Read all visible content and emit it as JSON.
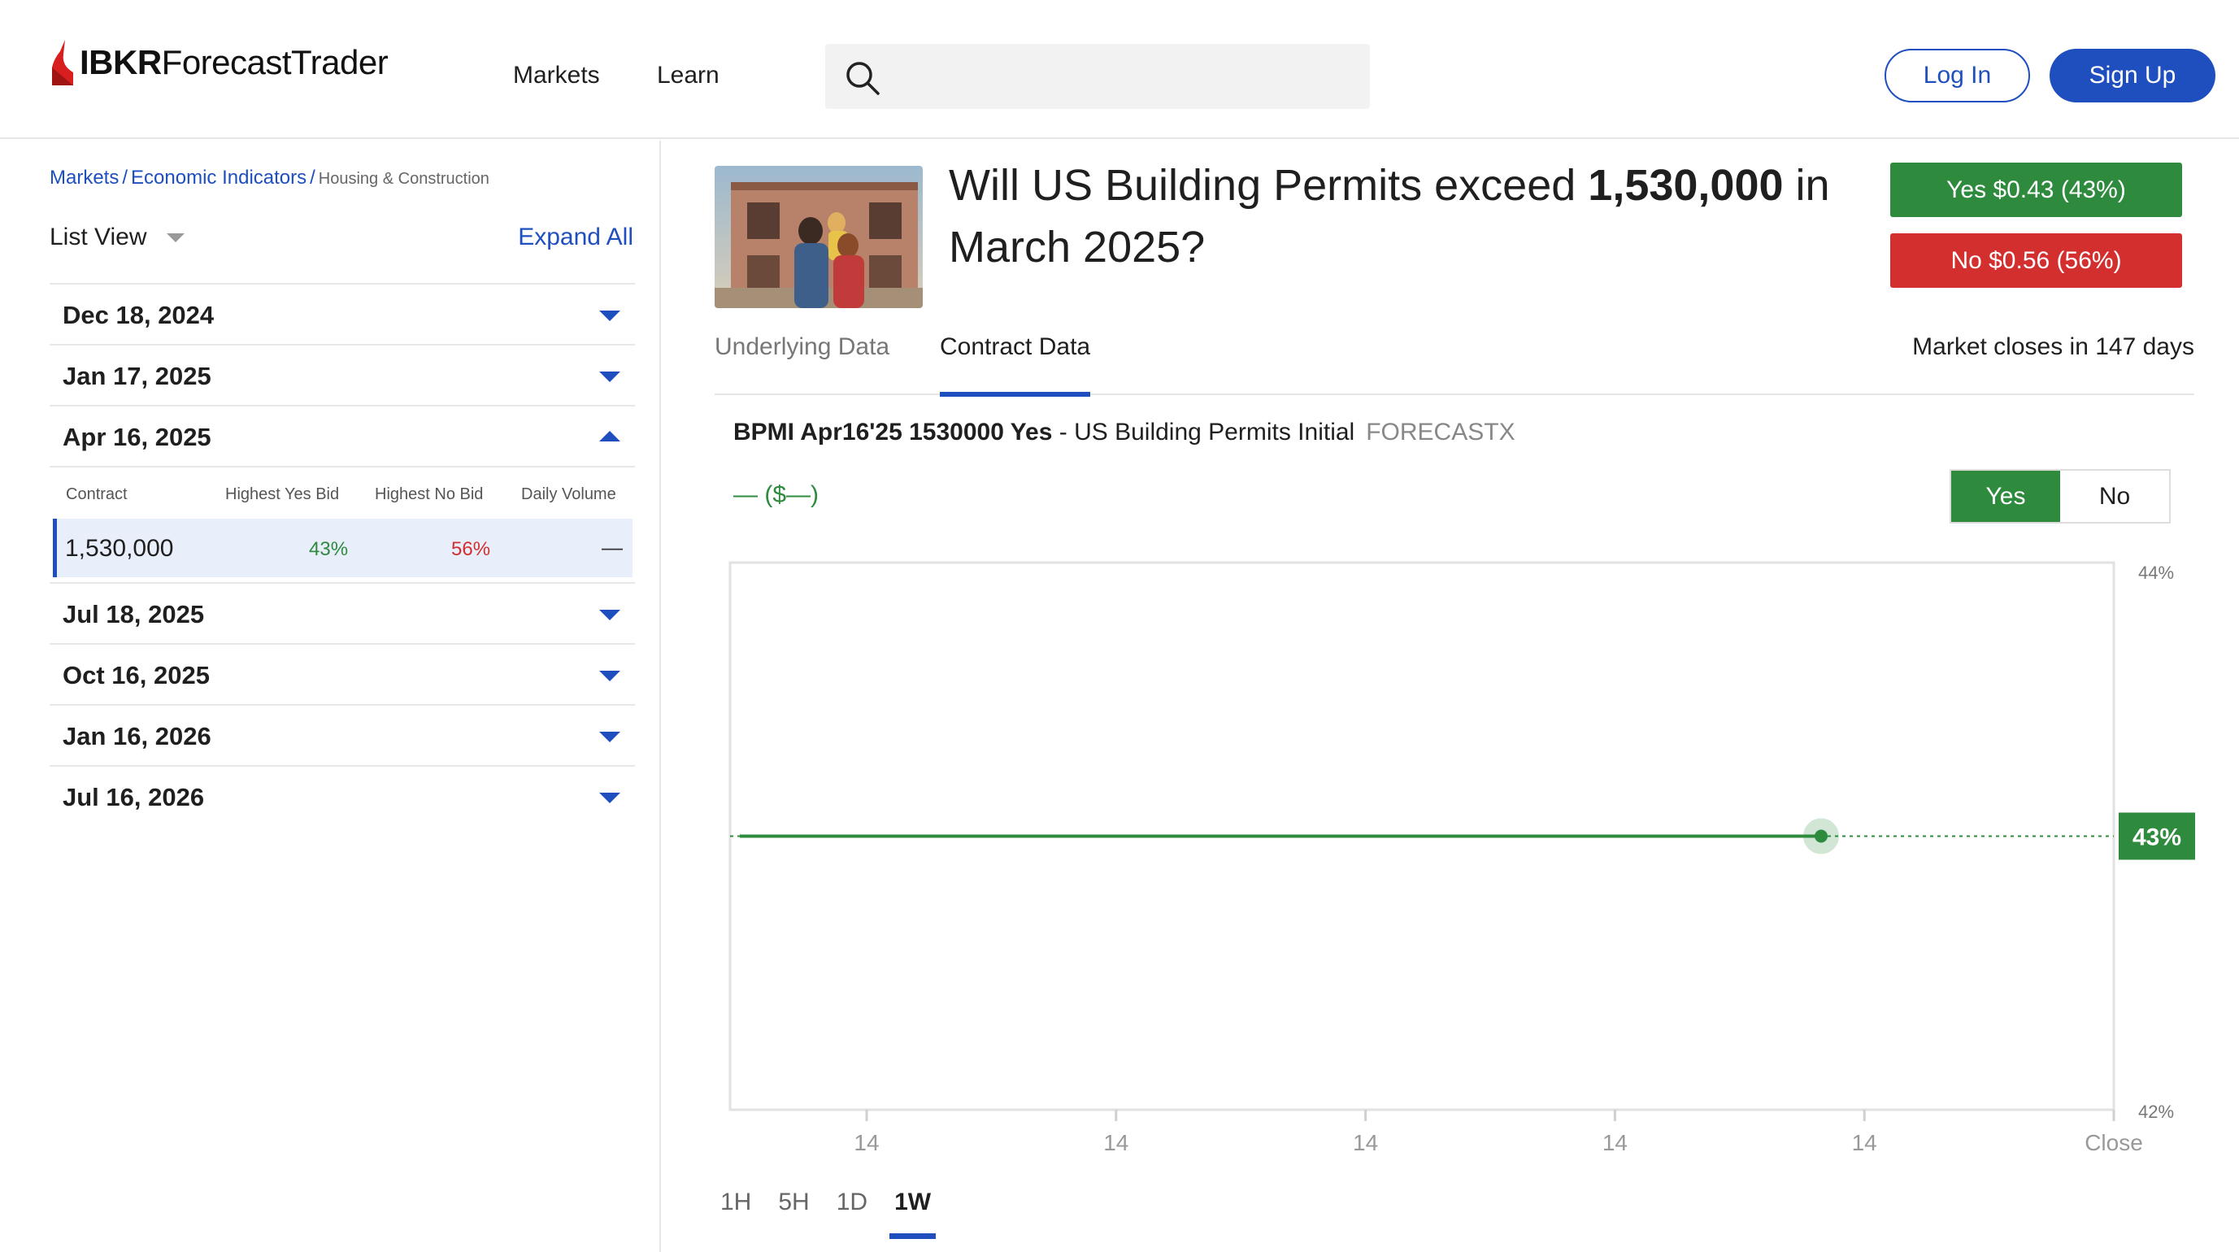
{
  "brand": {
    "bold": "IBKR",
    "regular": "ForecastTrader"
  },
  "nav": {
    "markets": "Markets",
    "learn": "Learn"
  },
  "search": {
    "placeholder": ""
  },
  "auth": {
    "login": "Log In",
    "signup": "Sign Up"
  },
  "breadcrumb": {
    "markets": "Markets",
    "sep": "/",
    "econ": "Economic Indicators",
    "current": "Housing & Construction"
  },
  "sidebar": {
    "list_view": "List View",
    "expand_all": "Expand All",
    "dates": [
      "Dec 18, 2024",
      "Jan 17, 2025",
      "Apr 16, 2025",
      "Jul 18, 2025",
      "Oct 16, 2025",
      "Jan 16, 2026",
      "Jul 16, 2026"
    ],
    "expanded_index": 2,
    "contract_headers": [
      "Contract",
      "Highest Yes Bid",
      "Highest No Bid",
      "Daily Volume"
    ],
    "contract_row": {
      "name": "1,530,000",
      "yes": "43%",
      "no": "56%",
      "volume": "—"
    }
  },
  "question": {
    "prefix": "Will US Building Permits exceed ",
    "strike": "1,530,000",
    "suffix": " in March 2025?"
  },
  "buy": {
    "yes": "Yes $0.43 (43%)",
    "no": "No $0.56 (56%)"
  },
  "tabs": {
    "underlying": "Underlying Data",
    "contract": "Contract Data"
  },
  "market_closes": "Market closes in 147 days",
  "contract": {
    "symbol": "BPMI Apr16'25 1530000 Yes",
    "dash": " - ",
    "name": "US Building Permits Initial",
    "source": "FORECASTX",
    "price": "— ($—)"
  },
  "toggle": {
    "yes": "Yes",
    "no": "No"
  },
  "ranges": [
    "1H",
    "5H",
    "1D",
    "1W"
  ],
  "active_range": "1W",
  "colors": {
    "accent": "#1f4fbf",
    "yes": "#2e8b3e",
    "no": "#d32f2f"
  },
  "chart_data": {
    "type": "line",
    "x_tick_labels": [
      "14",
      "14",
      "14",
      "14",
      "14",
      "Close"
    ],
    "ylim": [
      42,
      44
    ],
    "y_tick_labels": [
      "44%",
      "42%"
    ],
    "series": [
      {
        "values": [
          43,
          43,
          43,
          43,
          43,
          43,
          43,
          43,
          43,
          43
        ]
      }
    ],
    "current_value": 43,
    "current_label": "43%",
    "grid": false
  }
}
